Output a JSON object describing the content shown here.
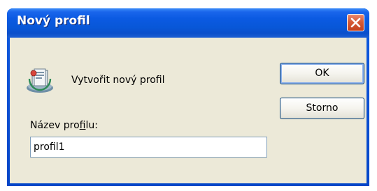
{
  "dialog": {
    "title": "Nový profil",
    "create_label": "Vytvořit nový profil",
    "name_label_before": "Název pro",
    "name_label_access": "f",
    "name_label_after": "ilu:",
    "name_value": "profil1",
    "ok_label": "OK",
    "cancel_label": "Storno"
  },
  "icons": {
    "close": "close-icon",
    "profile": "profile-icon"
  },
  "colors": {
    "titlebar": "#0B5AE2",
    "client": "#ECE9D8",
    "close_button": "#D65B37"
  }
}
